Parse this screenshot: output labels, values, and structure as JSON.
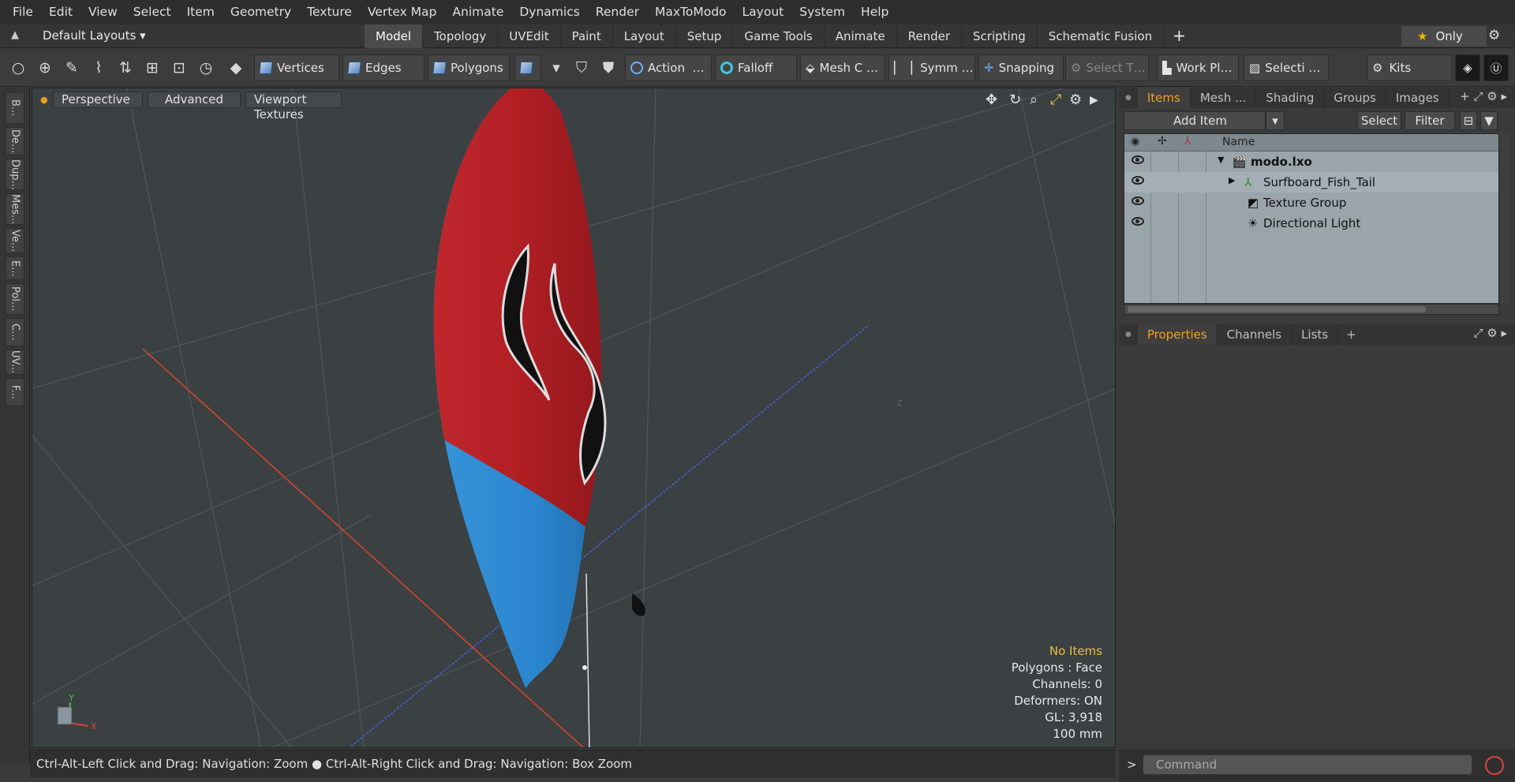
{
  "menu": [
    "File",
    "Edit",
    "View",
    "Select",
    "Item",
    "Geometry",
    "Texture",
    "Vertex Map",
    "Animate",
    "Dynamics",
    "Render",
    "MaxToModo",
    "Layout",
    "System",
    "Help"
  ],
  "layoutbar": {
    "layouts_label": "Default Layouts ▾",
    "tabs": [
      "Model",
      "Topology",
      "UVEdit",
      "Paint",
      "Layout",
      "Setup",
      "Game Tools",
      "Animate",
      "Render",
      "Scripting",
      "Schematic Fusion"
    ],
    "active_tab": "Model",
    "only_label": "Only"
  },
  "toolbar": {
    "vertices": "Vertices",
    "edges": "Edges",
    "polygons": "Polygons",
    "action": "Action",
    "action_more": "…",
    "falloff": "Falloff",
    "mesh_c": "Mesh C …",
    "symm": "Symm …",
    "snapping": "Snapping",
    "select_t": "Select T…",
    "work_pl": "Work Pl…",
    "selecti": "Selecti …",
    "kits": "Kits"
  },
  "leftstrip": [
    "B...",
    "De...",
    "Dup...",
    "Mes...",
    "Ve...",
    "E...",
    "Pol...",
    "C...",
    "UV...",
    "F..."
  ],
  "viewport": {
    "perspective": "Perspective",
    "advanced": "Advanced",
    "textures": "Viewport Textures",
    "info": {
      "items": "No Items",
      "polygons": "Polygons : Face",
      "channels": "Channels: 0",
      "deformers": "Deformers: ON",
      "gl": "GL: 3,918",
      "unit": "100 mm"
    }
  },
  "items_panel": {
    "tabs": [
      "Items",
      "Mesh ...",
      "Shading",
      "Groups",
      "Images"
    ],
    "active_tab": "Items",
    "add_item": "Add Item",
    "select": "Select",
    "filter": "Filter",
    "name_col": "Name",
    "tree": {
      "scene": "modo.lxo",
      "mesh": "Surfboard_Fish_Tail",
      "texture_group": "Texture Group",
      "light": "Directional Light"
    }
  },
  "properties_panel": {
    "tabs": [
      "Properties",
      "Channels",
      "Lists"
    ],
    "active_tab": "Properties"
  },
  "statusbar": {
    "hint_left": "Ctrl-Alt-Left Click and Drag: Navigation: Zoom",
    "hint_right": "Ctrl-Alt-Right Click and Drag: Navigation: Box Zoom"
  },
  "command": {
    "placeholder": "Command",
    "prompt": ">"
  },
  "colors": {
    "board_top": "#b52126",
    "board_bottom": "#2b86cf",
    "accent": "#f0a020",
    "axis_x": "#d9452b",
    "axis_z": "#4a5fe0"
  }
}
